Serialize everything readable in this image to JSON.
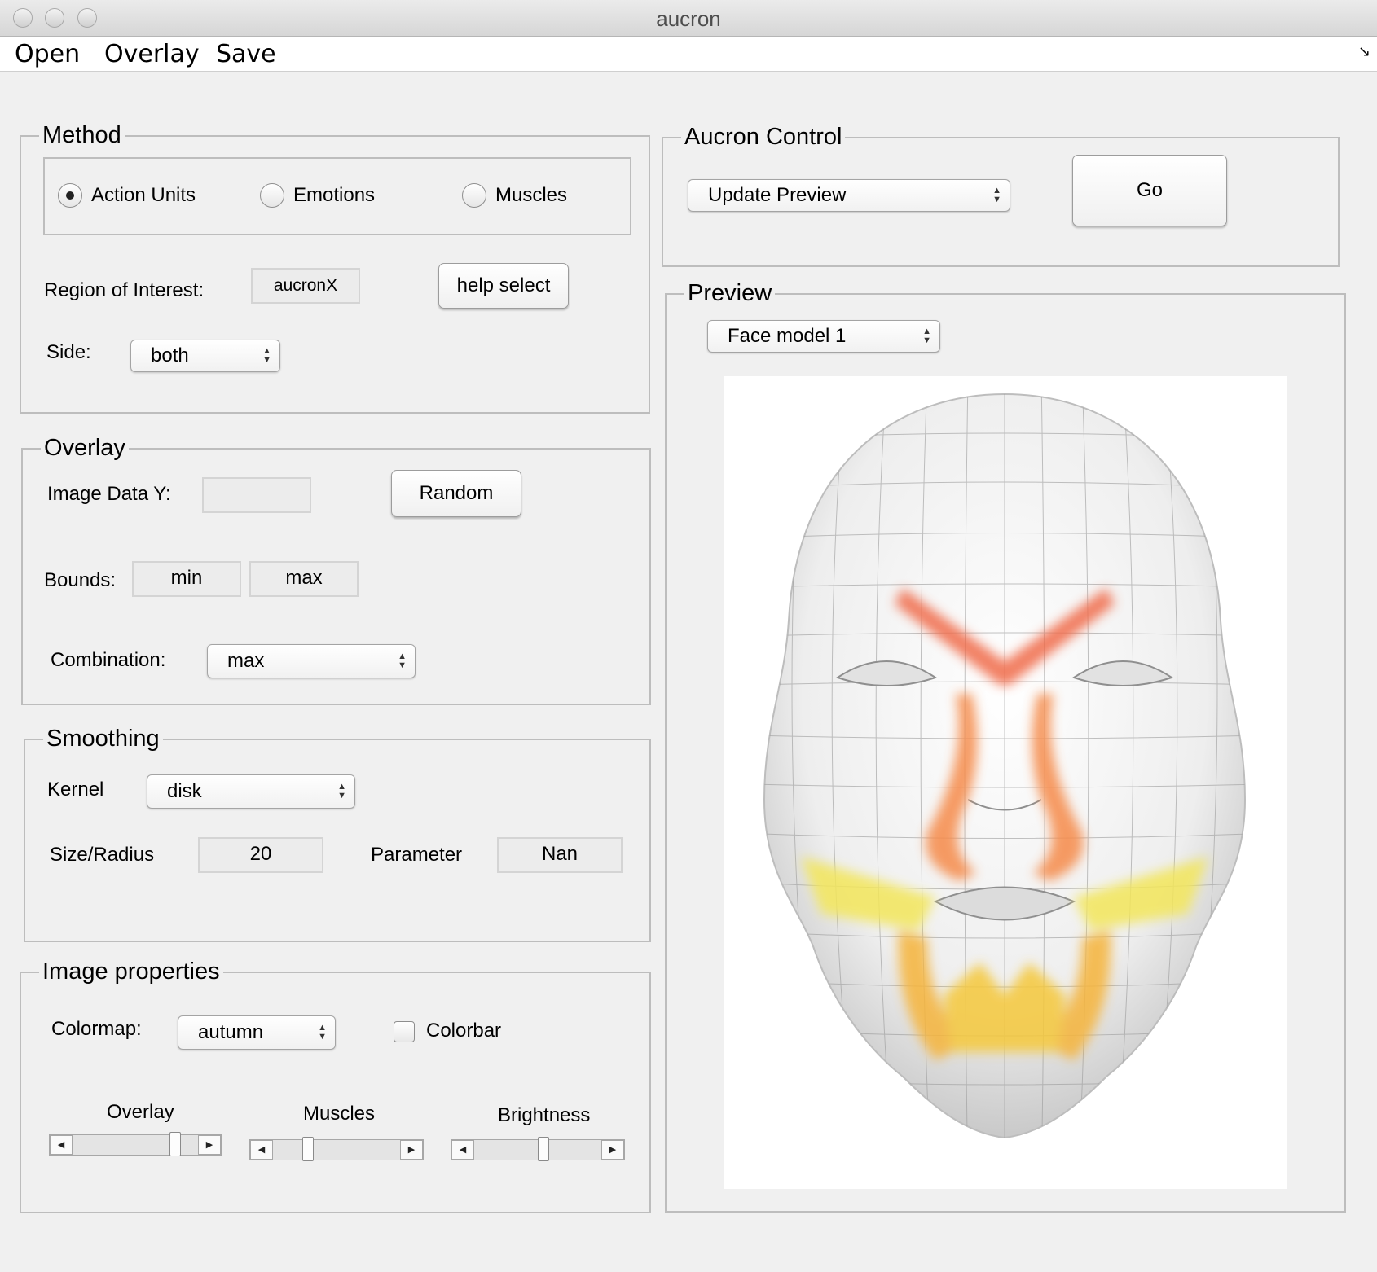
{
  "window": {
    "title": "aucron"
  },
  "menu": {
    "open": "Open",
    "overlay": "Overlay",
    "save": "Save"
  },
  "method": {
    "title": "Method",
    "radios": [
      {
        "label": "Action Units",
        "checked": true
      },
      {
        "label": "Emotions",
        "checked": false
      },
      {
        "label": "Muscles",
        "checked": false
      }
    ],
    "roi_label": "Region of Interest:",
    "roi_value": "aucronX",
    "help_button": "help select",
    "side_label": "Side:",
    "side_value": "both"
  },
  "overlay": {
    "title": "Overlay",
    "image_data_label": "Image Data Y:",
    "image_data_value": "",
    "random_button": "Random",
    "bounds_label": "Bounds:",
    "bounds_min": "min",
    "bounds_max": "max",
    "combination_label": "Combination:",
    "combination_value": "max"
  },
  "smoothing": {
    "title": "Smoothing",
    "kernel_label": "Kernel",
    "kernel_value": "disk",
    "size_label": "Size/Radius",
    "size_value": "20",
    "parameter_label": "Parameter",
    "parameter_value": "Nan"
  },
  "image_properties": {
    "title": "Image properties",
    "colormap_label": "Colormap:",
    "colormap_value": "autumn",
    "colorbar_label": "Colorbar",
    "colorbar_checked": false,
    "sliders": [
      {
        "label": "Overlay",
        "value": 0.85
      },
      {
        "label": "Muscles",
        "value": 0.25
      },
      {
        "label": "Brightness",
        "value": 0.55
      }
    ]
  },
  "aucron_control": {
    "title": "Aucron Control",
    "action_value": "Update Preview",
    "go_button": "Go"
  },
  "preview": {
    "title": "Preview",
    "model_value": "Face model 1"
  },
  "colors": {
    "overlay_red": "#f06a4a",
    "overlay_orange": "#f5a23a",
    "overlay_yellow": "#f3e65a"
  }
}
